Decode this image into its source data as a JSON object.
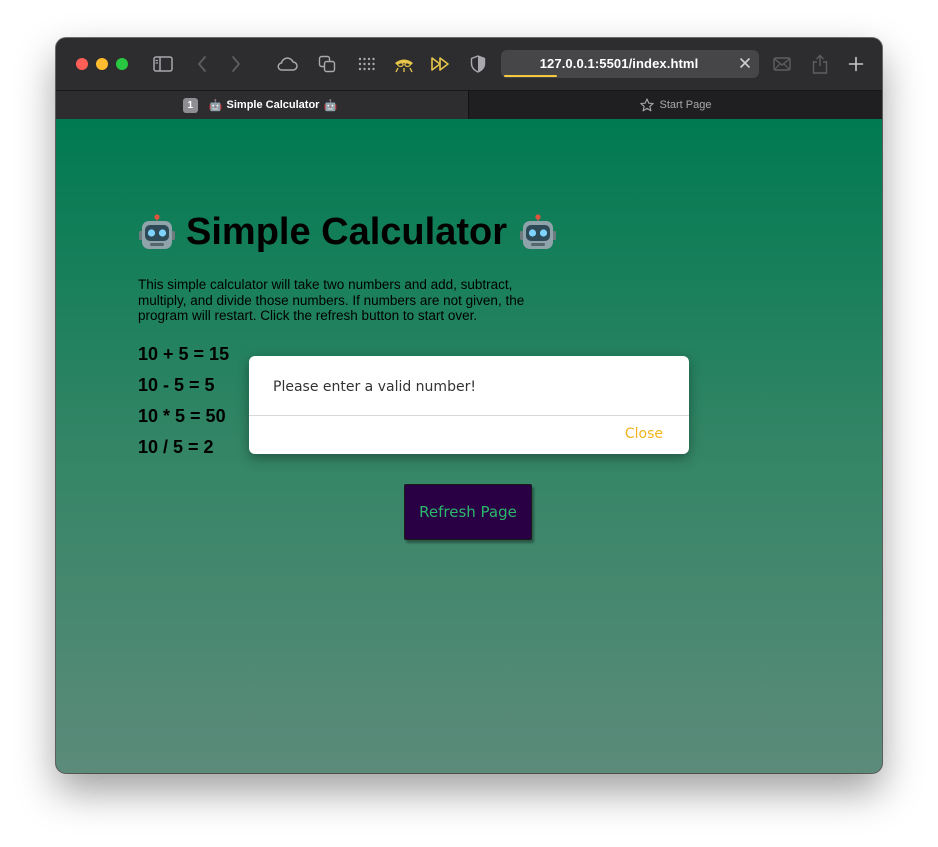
{
  "browser": {
    "url": "127.0.0.1:5501/index.html",
    "tabs": [
      {
        "number": "1",
        "emoji": "🤖",
        "title": "Simple Calculator",
        "active": true
      },
      {
        "title": "Start Page",
        "active": false
      }
    ],
    "accent_color": "#f5c842"
  },
  "page": {
    "heading": "Simple Calculator",
    "description": "This simple calculator will take two numbers and add, subtract, multiply, and divide those numbers. If numbers are not given, the program will restart. Click the refresh button to start over.",
    "results": [
      "10 + 5 = 15",
      "10 - 5 = 5",
      "10 * 5 = 50",
      "10 / 5 = 2"
    ],
    "refresh_label": "Refresh Page",
    "background_top": "#007a51",
    "background_bottom": "#5c8b7a",
    "button_bg": "#2a0045",
    "button_text_color": "#2ab86a"
  },
  "modal": {
    "message": "Please enter a valid number!",
    "close_label": "Close",
    "close_color": "#f2b41c"
  }
}
